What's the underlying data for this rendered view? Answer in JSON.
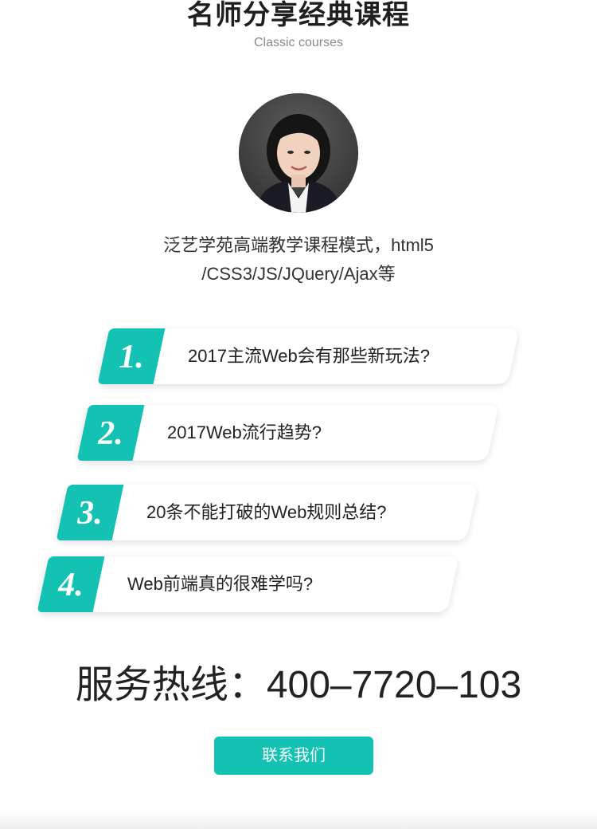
{
  "header": {
    "title": "名师分享经典课程",
    "subtitle": "Classic courses"
  },
  "teacher": {
    "avatar_alt": "teacher-avatar"
  },
  "description": {
    "line1": "泛艺学苑高端教学课程模式，html5",
    "line2": "/CSS3/JS/JQuery/Ajax等"
  },
  "courses": [
    {
      "number": "1.",
      "title": "2017主流Web会有那些新玩法?"
    },
    {
      "number": "2.",
      "title": "2017Web流行趋势?"
    },
    {
      "number": "3.",
      "title": "20条不能打破的Web规则总结?"
    },
    {
      "number": "4.",
      "title": "Web前端真的很难学吗?"
    }
  ],
  "hotline": {
    "label": "服务热线：",
    "number": "400–7720–103"
  },
  "contact_button": {
    "label": "联系我们"
  },
  "colors": {
    "accent": "#13c2b3",
    "text": "#222222",
    "muted": "#888888"
  }
}
